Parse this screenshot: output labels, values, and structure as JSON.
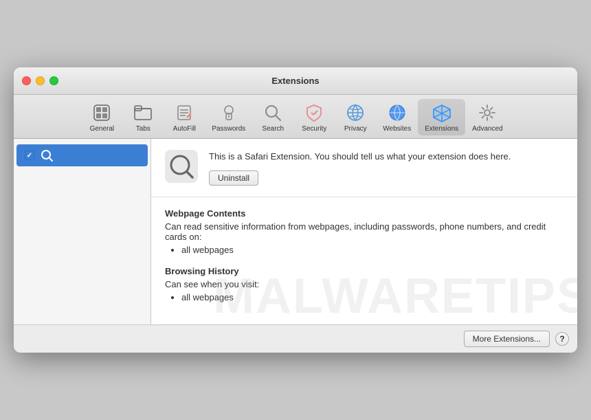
{
  "window": {
    "title": "Extensions"
  },
  "window_controls": {
    "close_label": "close",
    "minimize_label": "minimize",
    "maximize_label": "maximize"
  },
  "toolbar": {
    "items": [
      {
        "id": "general",
        "label": "General"
      },
      {
        "id": "tabs",
        "label": "Tabs"
      },
      {
        "id": "autofill",
        "label": "AutoFill"
      },
      {
        "id": "passwords",
        "label": "Passwords"
      },
      {
        "id": "search",
        "label": "Search"
      },
      {
        "id": "security",
        "label": "Security"
      },
      {
        "id": "privacy",
        "label": "Privacy"
      },
      {
        "id": "websites",
        "label": "Websites"
      },
      {
        "id": "extensions",
        "label": "Extensions",
        "active": true
      },
      {
        "id": "advanced",
        "label": "Advanced"
      }
    ]
  },
  "sidebar": {
    "items": [
      {
        "id": "search-ext",
        "checked": true,
        "label": ""
      }
    ]
  },
  "detail": {
    "ext_description": "This is a Safari Extension. You should tell us what your extension does here.",
    "uninstall_label": "Uninstall",
    "permissions": [
      {
        "title": "Webpage Contents",
        "description": "Can read sensitive information from webpages, including passwords, phone numbers, and credit cards on:",
        "items": [
          "all webpages"
        ]
      },
      {
        "title": "Browsing History",
        "description": "Can see when you visit:",
        "items": [
          "all webpages"
        ]
      }
    ]
  },
  "footer": {
    "more_extensions_label": "More Extensions...",
    "help_label": "?"
  },
  "watermark": {
    "text": "MALWARETIPS"
  }
}
